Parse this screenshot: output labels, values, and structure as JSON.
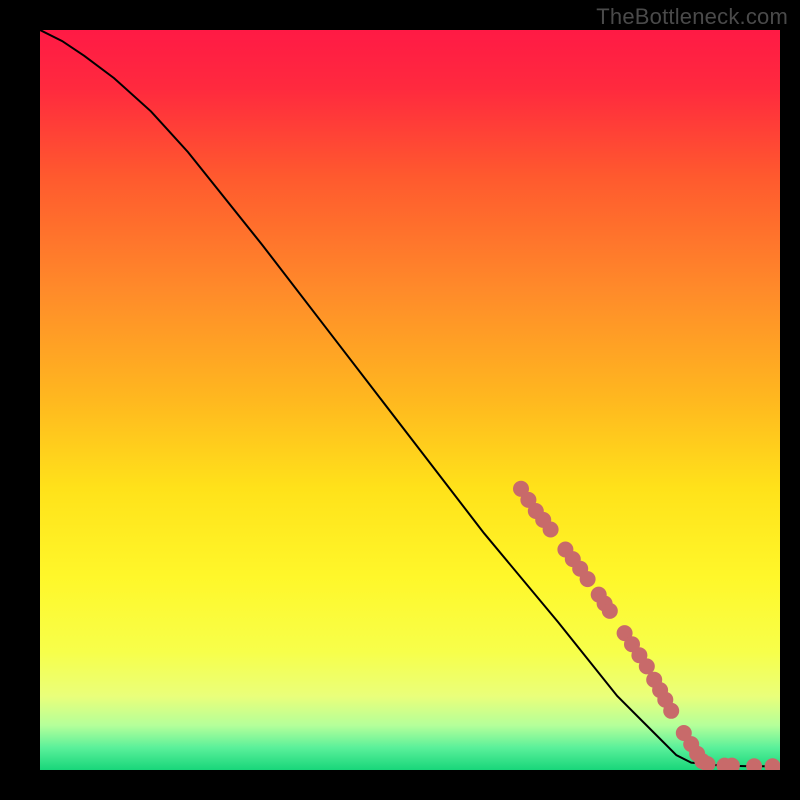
{
  "watermark": "TheBottleneck.com",
  "colors": {
    "gradient_stops": [
      {
        "offset": 0.0,
        "color": "#ff1a45"
      },
      {
        "offset": 0.08,
        "color": "#ff2a3e"
      },
      {
        "offset": 0.2,
        "color": "#ff5a2e"
      },
      {
        "offset": 0.35,
        "color": "#ff8a2a"
      },
      {
        "offset": 0.5,
        "color": "#ffb81f"
      },
      {
        "offset": 0.62,
        "color": "#ffe21a"
      },
      {
        "offset": 0.74,
        "color": "#fff72a"
      },
      {
        "offset": 0.84,
        "color": "#f7ff4a"
      },
      {
        "offset": 0.9,
        "color": "#eaff7a"
      },
      {
        "offset": 0.94,
        "color": "#b4ff9a"
      },
      {
        "offset": 0.97,
        "color": "#5af09a"
      },
      {
        "offset": 1.0,
        "color": "#18d67a"
      }
    ],
    "curve": "#000000",
    "marker_fill": "#c86a6a",
    "marker_stroke": "#b85a5a"
  },
  "chart_data": {
    "type": "line",
    "title": "",
    "xlabel": "",
    "ylabel": "",
    "xlim": [
      0,
      100
    ],
    "ylim": [
      0,
      100
    ],
    "curve": [
      {
        "x": 0,
        "y": 100
      },
      {
        "x": 3,
        "y": 98.5
      },
      {
        "x": 6,
        "y": 96.5
      },
      {
        "x": 10,
        "y": 93.5
      },
      {
        "x": 15,
        "y": 89
      },
      {
        "x": 20,
        "y": 83.5
      },
      {
        "x": 30,
        "y": 71
      },
      {
        "x": 40,
        "y": 58
      },
      {
        "x": 50,
        "y": 45
      },
      {
        "x": 60,
        "y": 32
      },
      {
        "x": 70,
        "y": 20
      },
      {
        "x": 78,
        "y": 10
      },
      {
        "x": 83,
        "y": 5
      },
      {
        "x": 86,
        "y": 2
      },
      {
        "x": 88,
        "y": 1
      },
      {
        "x": 92,
        "y": 0.6
      },
      {
        "x": 96,
        "y": 0.5
      },
      {
        "x": 100,
        "y": 0.5
      }
    ],
    "markers": [
      {
        "x": 65,
        "y": 38.0
      },
      {
        "x": 66,
        "y": 36.5
      },
      {
        "x": 67,
        "y": 35.0
      },
      {
        "x": 68,
        "y": 33.8
      },
      {
        "x": 69,
        "y": 32.5
      },
      {
        "x": 71,
        "y": 29.8
      },
      {
        "x": 72,
        "y": 28.5
      },
      {
        "x": 73,
        "y": 27.2
      },
      {
        "x": 74,
        "y": 25.8
      },
      {
        "x": 75.5,
        "y": 23.7
      },
      {
        "x": 76.3,
        "y": 22.5
      },
      {
        "x": 77,
        "y": 21.5
      },
      {
        "x": 79,
        "y": 18.5
      },
      {
        "x": 80,
        "y": 17.0
      },
      {
        "x": 81,
        "y": 15.5
      },
      {
        "x": 82,
        "y": 14.0
      },
      {
        "x": 83,
        "y": 12.2
      },
      {
        "x": 83.8,
        "y": 10.8
      },
      {
        "x": 84.5,
        "y": 9.5
      },
      {
        "x": 85.3,
        "y": 8.0
      },
      {
        "x": 87,
        "y": 5.0
      },
      {
        "x": 88,
        "y": 3.5
      },
      {
        "x": 88.8,
        "y": 2.2
      },
      {
        "x": 89.5,
        "y": 1.2
      },
      {
        "x": 90.2,
        "y": 0.8
      },
      {
        "x": 92.5,
        "y": 0.6
      },
      {
        "x": 93.5,
        "y": 0.6
      },
      {
        "x": 96.5,
        "y": 0.5
      },
      {
        "x": 99.0,
        "y": 0.5
      }
    ]
  }
}
